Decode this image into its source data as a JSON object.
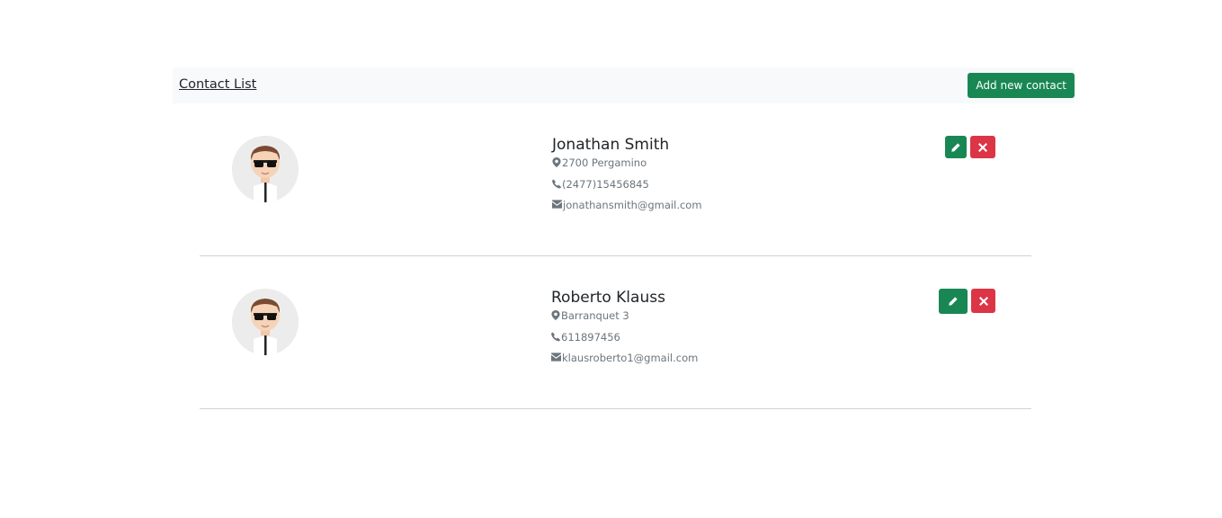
{
  "navbar": {
    "brand": "Contact List",
    "add_button_label": "Add new contact",
    "background": "#f8f9fa"
  },
  "contacts": [
    {
      "name": "Jonathan Smith",
      "address": "2700 Pergamino",
      "phone": "(2477)15456845",
      "email": "jonathansmith@gmail.com",
      "avatar_icon": "cartoon-man-sunglasses-avatar"
    },
    {
      "name": "Roberto Klauss",
      "address": "Barranquet 3",
      "phone": "611897456",
      "email": "klausroberto1@gmail.com",
      "avatar_icon": "cartoon-man-sunglasses-avatar"
    }
  ],
  "icons": {
    "address": "location-pin-icon",
    "phone": "phone-icon",
    "email": "envelope-icon",
    "edit": "pencil-icon",
    "delete": "close-icon"
  },
  "colors": {
    "success": "#198754",
    "danger": "#dc3545",
    "muted": "#6c757d"
  }
}
